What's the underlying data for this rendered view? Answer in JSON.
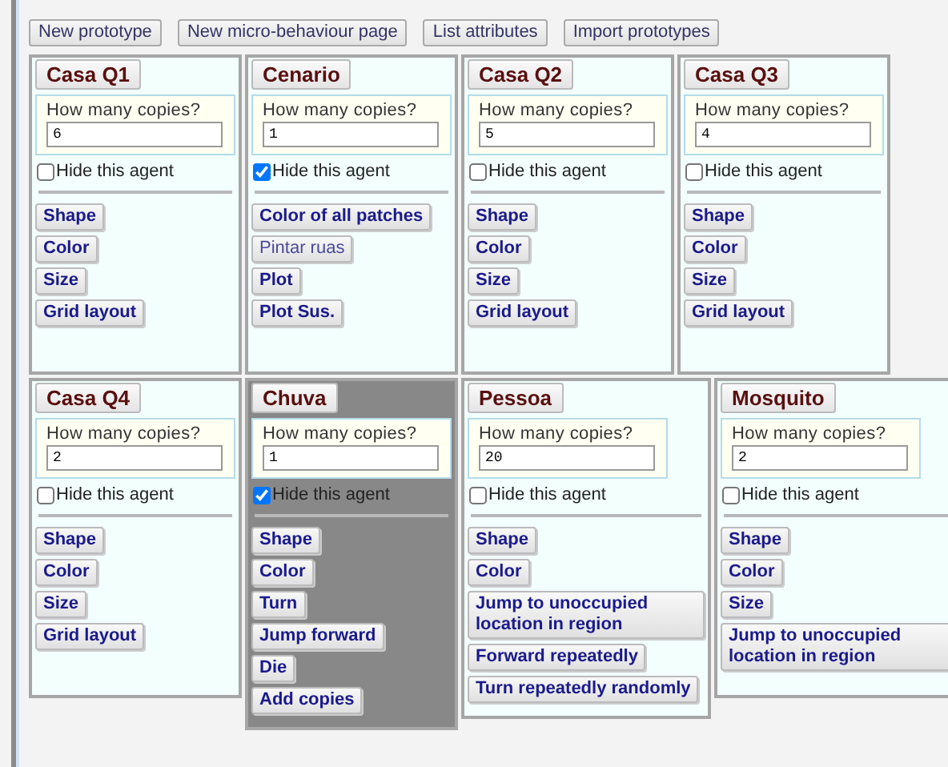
{
  "toolbar": [
    "New prototype",
    "New micro-behaviour page",
    "List attributes",
    "Import prototypes"
  ],
  "agents": [
    {
      "name": "Casa Q1",
      "copies_label": "How many copies?",
      "copies": "6",
      "hide_label": "Hide this agent",
      "hidden": false,
      "selected": false,
      "buttons": [
        {
          "label": "Shape",
          "kind": "action"
        },
        {
          "label": "Color",
          "kind": "action"
        },
        {
          "label": "Size",
          "kind": "action"
        },
        {
          "label": "Grid layout",
          "kind": "action"
        }
      ]
    },
    {
      "name": "Cenario",
      "copies_label": "How many copies?",
      "copies": "1",
      "hide_label": "Hide this agent",
      "hidden": true,
      "selected": false,
      "buttons": [
        {
          "label": "Color of all patches",
          "kind": "action"
        },
        {
          "label": "Pintar ruas",
          "kind": "plain"
        },
        {
          "label": "Plot",
          "kind": "action"
        },
        {
          "label": "Plot Sus.",
          "kind": "action"
        }
      ]
    },
    {
      "name": "Casa Q2",
      "copies_label": "How many copies?",
      "copies": "5",
      "hide_label": "Hide this agent",
      "hidden": false,
      "selected": false,
      "buttons": [
        {
          "label": "Shape",
          "kind": "action"
        },
        {
          "label": "Color",
          "kind": "action"
        },
        {
          "label": "Size",
          "kind": "action"
        },
        {
          "label": "Grid layout",
          "kind": "action"
        }
      ]
    },
    {
      "name": "Casa Q3",
      "copies_label": "How many copies?",
      "copies": "4",
      "hide_label": "Hide this agent",
      "hidden": false,
      "selected": false,
      "buttons": [
        {
          "label": "Shape",
          "kind": "action"
        },
        {
          "label": "Color",
          "kind": "action"
        },
        {
          "label": "Size",
          "kind": "action"
        },
        {
          "label": "Grid layout",
          "kind": "action"
        }
      ]
    },
    {
      "name": "Casa Q4",
      "copies_label": "How many copies?",
      "copies": "2",
      "hide_label": "Hide this agent",
      "hidden": false,
      "selected": false,
      "buttons": [
        {
          "label": "Shape",
          "kind": "action"
        },
        {
          "label": "Color",
          "kind": "action"
        },
        {
          "label": "Size",
          "kind": "action"
        },
        {
          "label": "Grid layout",
          "kind": "action"
        }
      ]
    },
    {
      "name": "Chuva",
      "copies_label": "How many copies?",
      "copies": "1",
      "hide_label": "Hide this agent",
      "hidden": true,
      "selected": true,
      "buttons": [
        {
          "label": "Shape",
          "kind": "action"
        },
        {
          "label": "Color",
          "kind": "action"
        },
        {
          "label": "Turn",
          "kind": "action"
        },
        {
          "label": "Jump forward",
          "kind": "action"
        },
        {
          "label": "Die",
          "kind": "action"
        },
        {
          "label": "Add copies",
          "kind": "action"
        }
      ]
    },
    {
      "name": "Pessoa",
      "copies_label": "How many copies?",
      "copies": "20",
      "hide_label": "Hide this agent",
      "hidden": false,
      "selected": false,
      "buttons": [
        {
          "label": "Shape",
          "kind": "action"
        },
        {
          "label": "Color",
          "kind": "action"
        },
        {
          "label": "Jump to unoccupied location in region",
          "kind": "action"
        },
        {
          "label": "Forward repeatedly",
          "kind": "action"
        },
        {
          "label": "Turn repeatedly randomly",
          "kind": "action"
        }
      ]
    },
    {
      "name": "Mosquito",
      "copies_label": "How many copies?",
      "copies": "2",
      "hide_label": "Hide this agent",
      "hidden": false,
      "selected": false,
      "buttons": [
        {
          "label": "Shape",
          "kind": "action"
        },
        {
          "label": "Color",
          "kind": "action"
        },
        {
          "label": "Size",
          "kind": "action"
        },
        {
          "label": "Jump to unoccupied location in region",
          "kind": "action"
        }
      ]
    }
  ]
}
